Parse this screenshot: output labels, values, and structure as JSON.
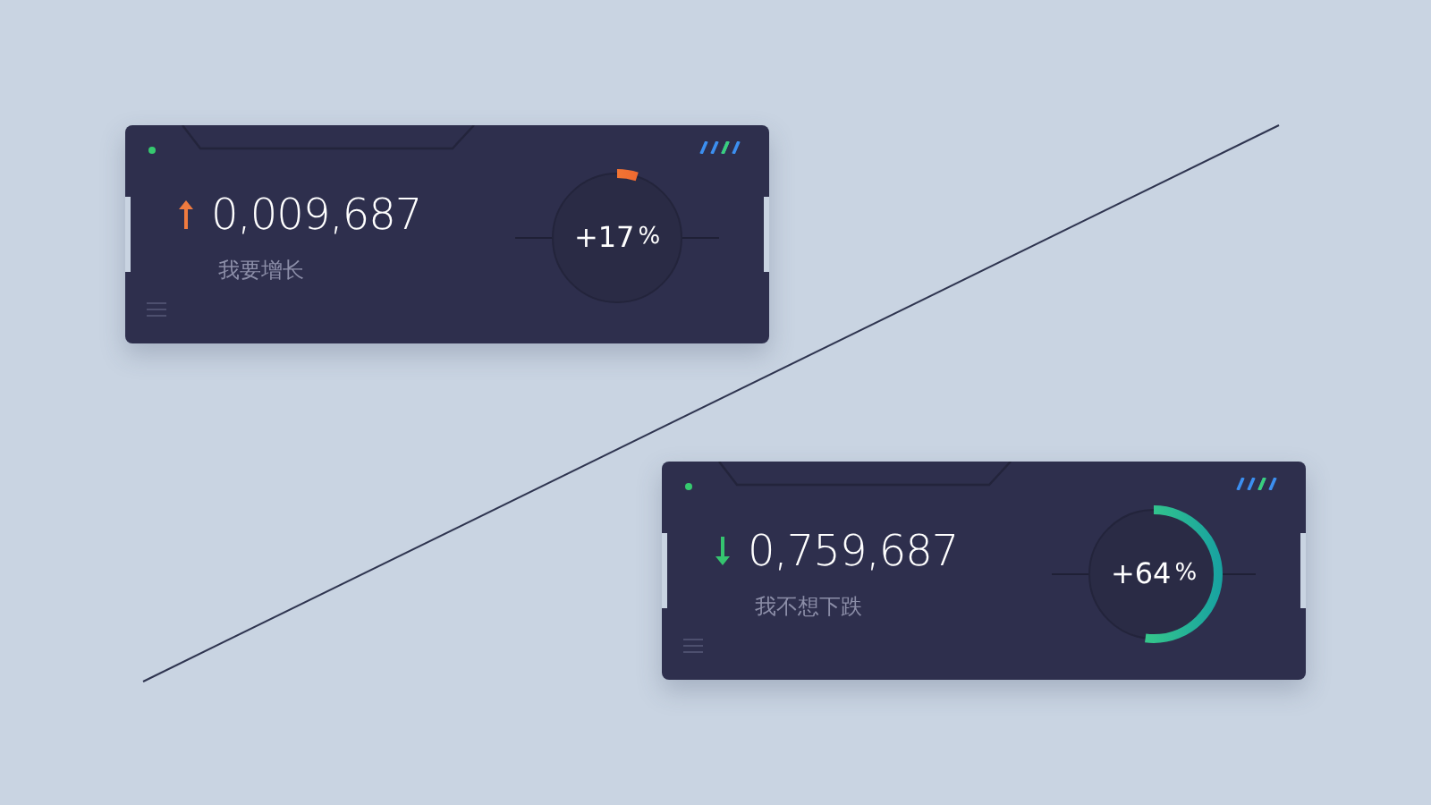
{
  "cards": [
    {
      "kind": "up",
      "value": "0,009,687",
      "label": "我要增长",
      "percent_value": "+17",
      "percent_unit": "%",
      "level": 0.05
    },
    {
      "kind": "down",
      "value": "0,759,687",
      "label": "我不想下跌",
      "percent_value": "+64",
      "percent_unit": "%",
      "level": 0.52
    }
  ]
}
